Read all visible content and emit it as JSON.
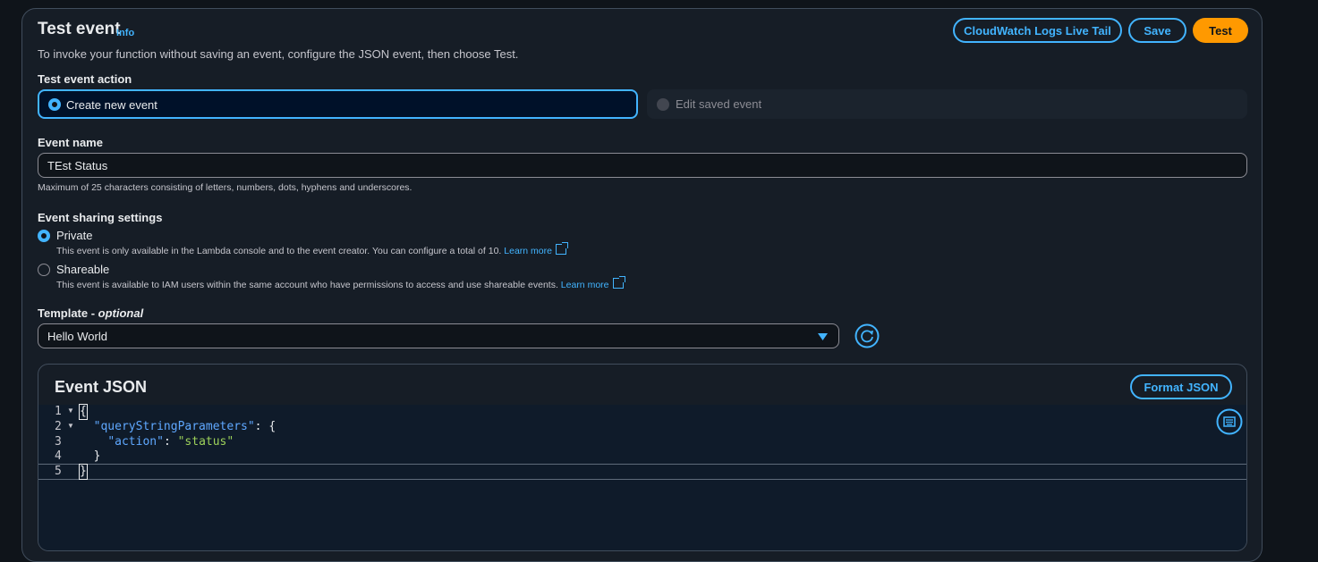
{
  "header": {
    "title": "Test event",
    "info": "Info",
    "description": "To invoke your function without saving an event, configure the JSON event, then choose Test.",
    "buttons": {
      "live_tail": "CloudWatch Logs Live Tail",
      "save": "Save",
      "test": "Test"
    }
  },
  "action": {
    "label": "Test event action",
    "create": "Create new event",
    "edit": "Edit saved event"
  },
  "event_name": {
    "label": "Event name",
    "value": "TEst Status",
    "hint": "Maximum of 25 characters consisting of letters, numbers, dots, hyphens and underscores."
  },
  "sharing": {
    "label": "Event sharing settings",
    "private_label": "Private",
    "private_desc": "This event is only available in the Lambda console and to the event creator. You can configure a total of 10.",
    "shareable_label": "Shareable",
    "shareable_desc": "This event is available to IAM users within the same account who have permissions to access and use shareable events.",
    "learn_more": "Learn more"
  },
  "template": {
    "label": "Template - ",
    "label_optional": "optional",
    "value": "Hello World"
  },
  "event_json": {
    "title": "Event JSON",
    "format_button": "Format JSON",
    "lines": [
      {
        "num": "1",
        "text": "{"
      },
      {
        "num": "2",
        "key": "\"queryStringParameters\"",
        "rest": ": {"
      },
      {
        "num": "3",
        "key": "\"action\"",
        "sep": ": ",
        "value": "\"status\""
      },
      {
        "num": "4",
        "text": "}"
      },
      {
        "num": "5",
        "text": "}"
      }
    ]
  },
  "colors": {
    "accent": "#42b4ff",
    "primary": "#ff9900",
    "background": "#0f141a"
  }
}
